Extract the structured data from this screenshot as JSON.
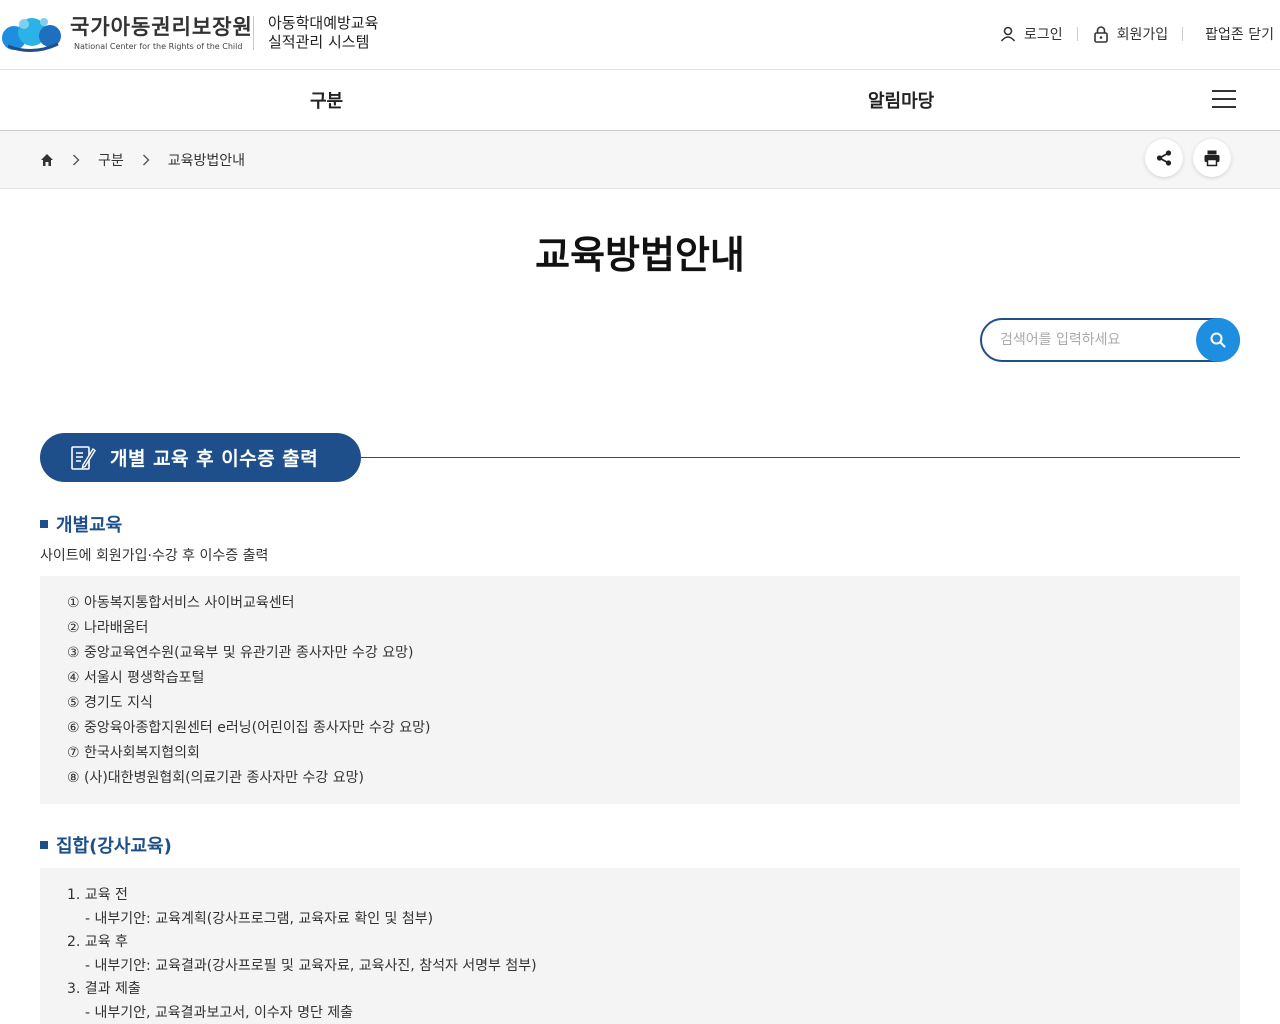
{
  "header": {
    "logo_ko": "국가아동권리보장원",
    "logo_en": "National Center for the Rights of the Child",
    "site_name_line1": "아동학대예방교육",
    "site_name_line2": "실적관리 시스템",
    "login": "로그인",
    "signup": "회원가입",
    "popup_close": "팝업존 닫기"
  },
  "nav": {
    "items": [
      "구분",
      "알림마당"
    ]
  },
  "breadcrumb": {
    "level1": "구분",
    "level2": "교육방법안내"
  },
  "page": {
    "title": "교육방법안내"
  },
  "search": {
    "placeholder": "검색어를 입력하세요"
  },
  "section": {
    "banner": "개별 교육 후 이수증 출력",
    "individual": {
      "title": "개별교육",
      "desc": "사이트에 회원가입·수강 후 이수증 출력",
      "items": [
        "① 아동복지통합서비스 사이버교육센터",
        "② 나라배움터",
        "③ 중앙교육연수원(교육부 및 유관기관 종사자만 수강 요망)",
        "④ 서울시 평생학습포털",
        "⑤ 경기도 지식",
        "⑥ 중앙육아종합지원센터 e러닝(어린이집 종사자만 수강 요망)",
        "⑦ 한국사회복지협의회",
        "⑧ (사)대한병원협회(의료기관 종사자만 수강 요망)"
      ]
    },
    "group": {
      "title": "집합(강사교육)",
      "steps": [
        {
          "label": "1. 교육 전",
          "detail": "- 내부기안: 교육계획(강사프로그램, 교육자료 확인 및 첨부)"
        },
        {
          "label": "2. 교육 후",
          "detail": "- 내부기안: 교육결과(강사프로필 및 교육자료, 교육사진, 참석자 서명부 첨부)"
        },
        {
          "label": "3. 결과 제출",
          "detail": "- 내부기안, 교육결과보고서, 이수자 명단 제출"
        }
      ]
    }
  },
  "colors": {
    "primary": "#1e4f8a",
    "search_button": "#1e8fe0",
    "box_bg": "#f4f4f4"
  }
}
